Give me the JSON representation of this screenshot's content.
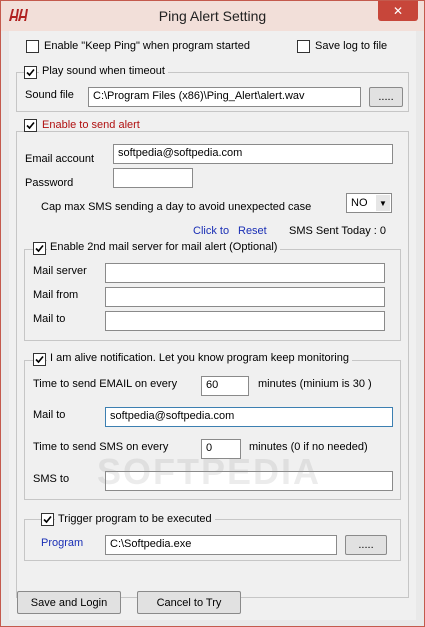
{
  "window": {
    "title": "Ping Alert Setting",
    "close_label": "✕"
  },
  "top": {
    "keep_ping_label": "Enable \"Keep Ping\" when program started",
    "save_log_label": "Save log to file"
  },
  "sound": {
    "play_label": "Play sound when timeout",
    "file_label": "Sound file",
    "file_value": "C:\\Program Files (x86)\\Ping_Alert\\alert.wav",
    "browse_label": "....."
  },
  "alert": {
    "enable_label": "Enable to send alert",
    "email_label": "Email account",
    "email_value": "softpedia@softpedia.com",
    "password_label": "Password",
    "password_value": "",
    "cap_label": "Cap max SMS sending a day to avoid unexpected case",
    "cap_value": "NO",
    "click_to_label": "Click to",
    "reset_label": "Reset",
    "sms_sent_label": "SMS Sent Today : 0"
  },
  "mail2": {
    "enable_label": "Enable 2nd mail server for mail alert (Optional)",
    "server_label": "Mail server",
    "from_label": "Mail from",
    "to_label": "Mail to"
  },
  "alive": {
    "enable_label": "I am alive notification. Let you know program keep monitoring",
    "email_every_label": "Time to send EMAIL on every",
    "email_every_value": "60",
    "email_unit_label": "minutes (minium is 30 )",
    "mail_to_label": "Mail to",
    "mail_to_value": "softpedia@softpedia.com",
    "sms_every_label": "Time to send SMS on every",
    "sms_every_value": "0",
    "sms_unit_label": "minutes (0 if no needed)",
    "sms_to_label": "SMS to"
  },
  "trigger": {
    "enable_label": "Trigger program to be executed",
    "program_label": "Program",
    "program_value": "C:\\Softpedia.exe",
    "browse_label": "....."
  },
  "buttons": {
    "save_login_label": "Save and Login",
    "cancel_label": "Cancel to Try"
  },
  "watermark": "SOFTPEDIA"
}
